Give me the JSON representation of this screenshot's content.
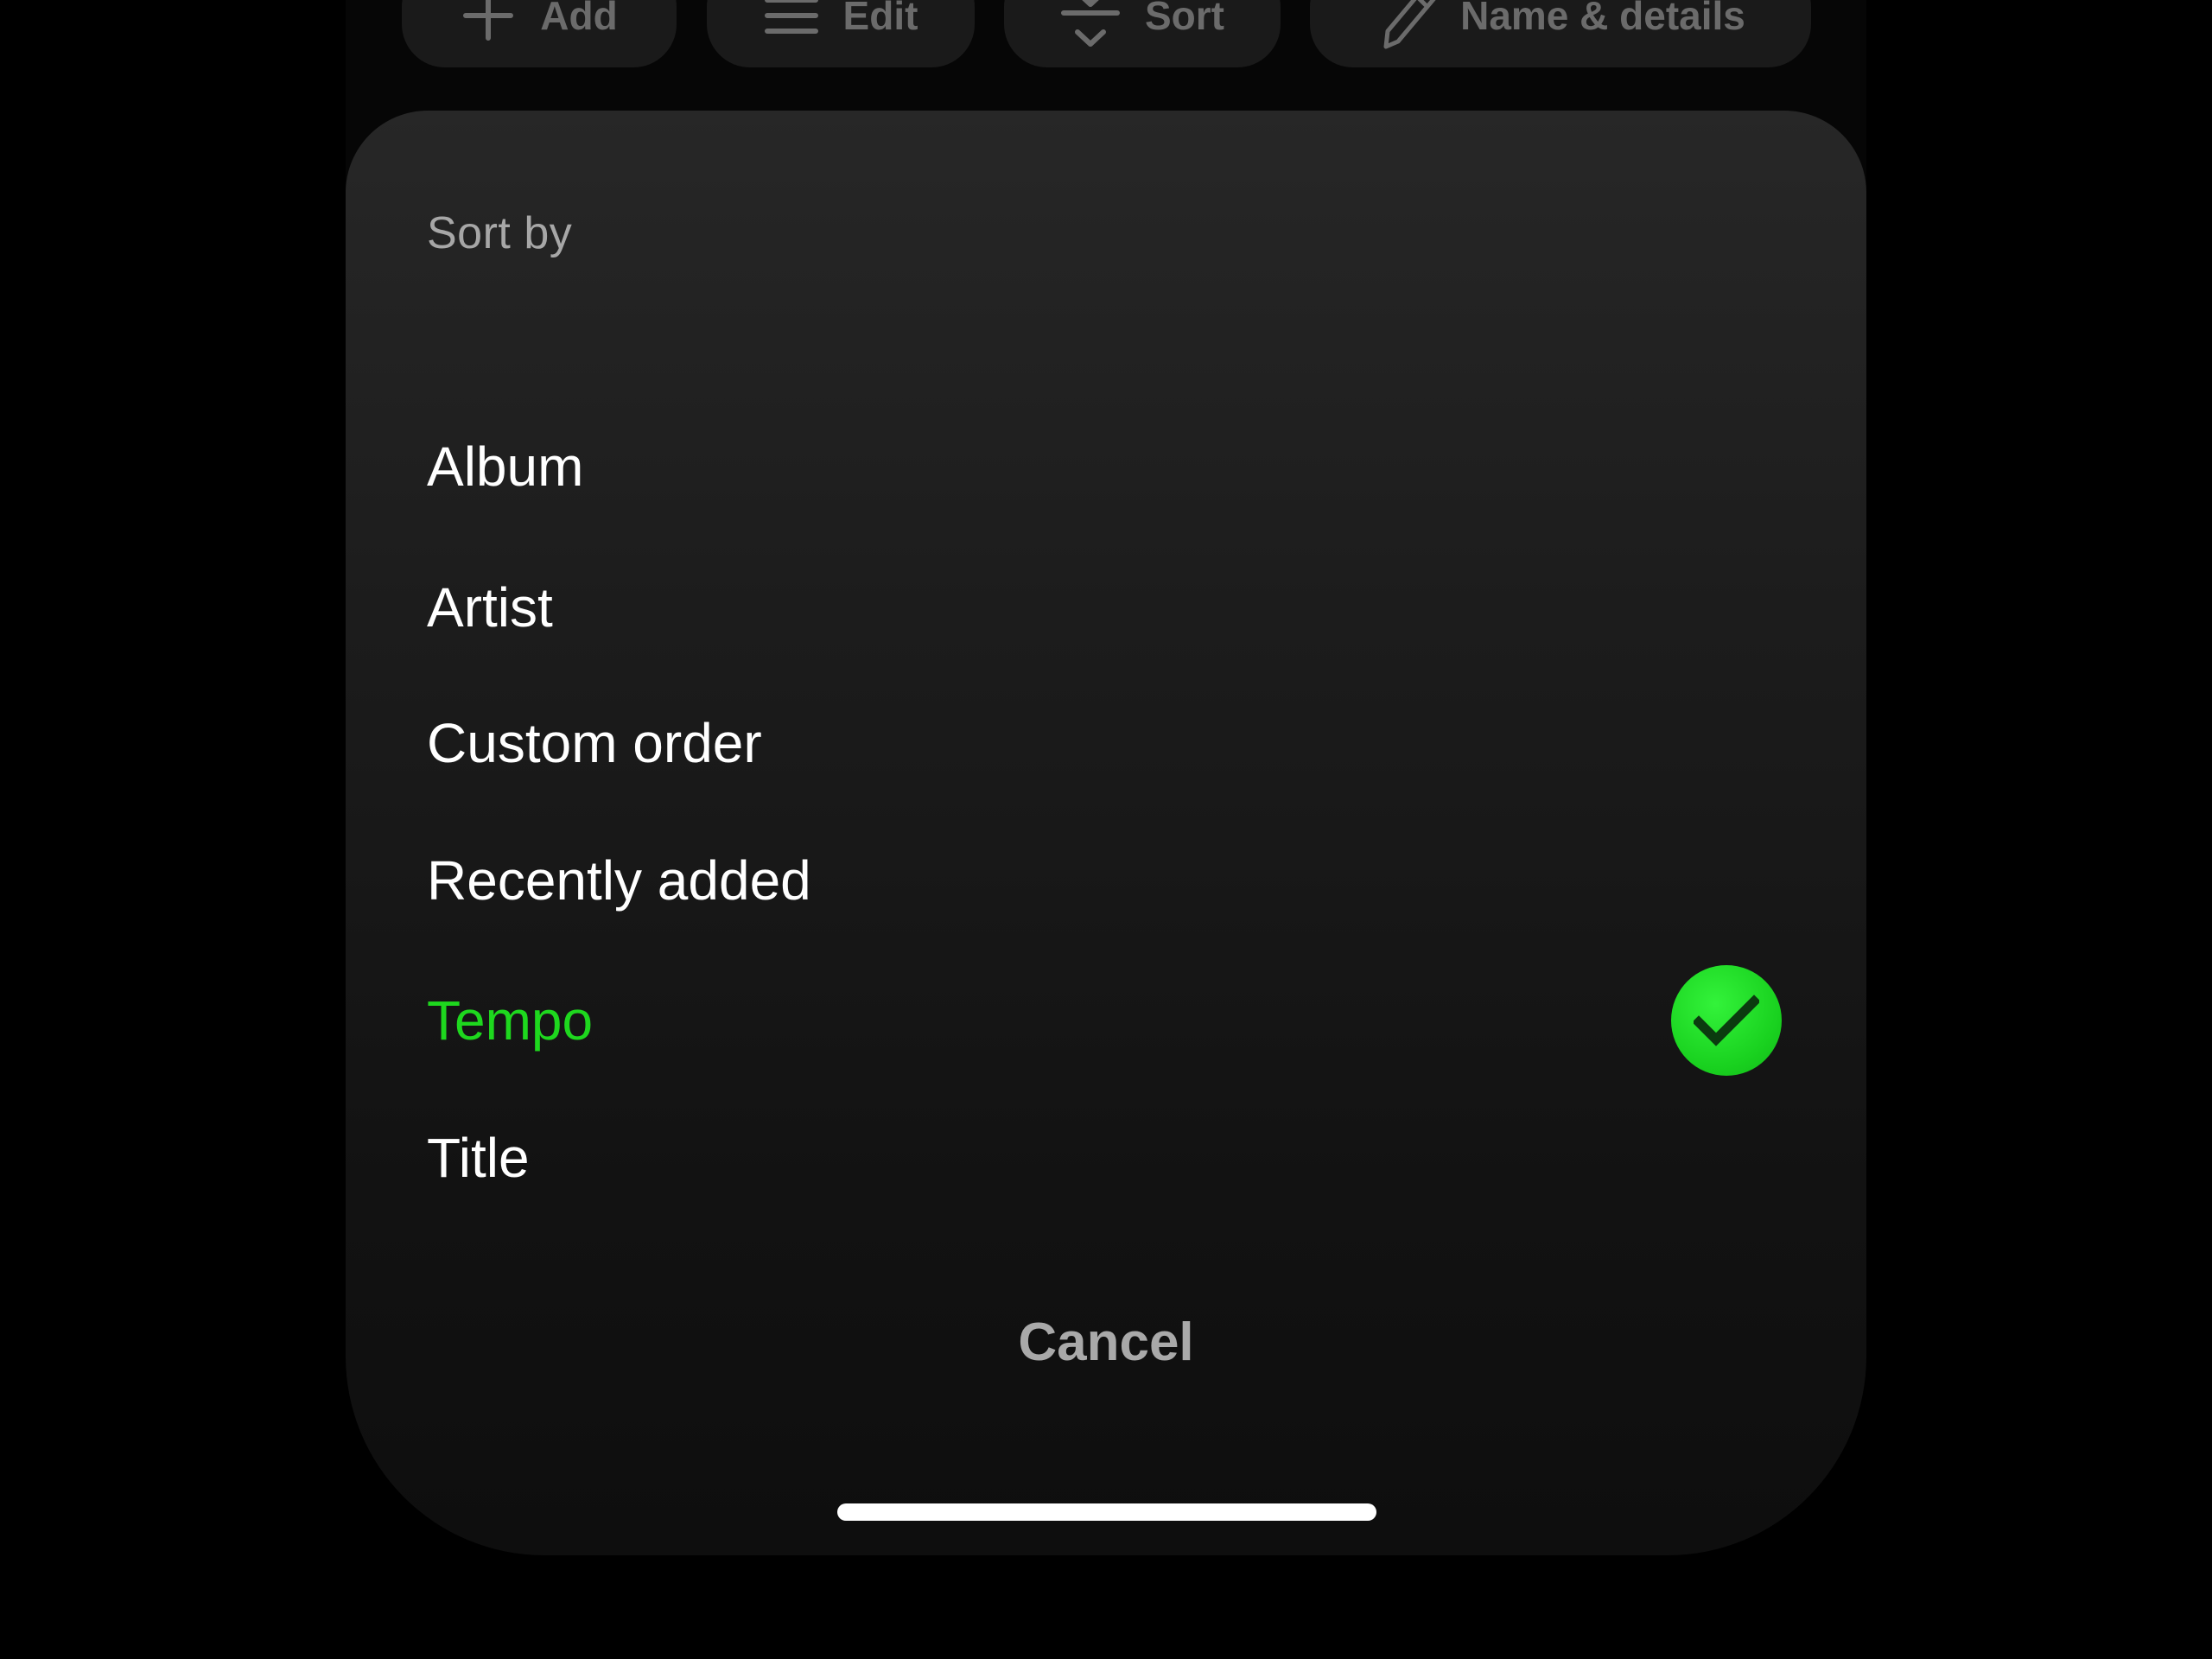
{
  "toolbar": {
    "add_label": "Add",
    "edit_label": "Edit",
    "sort_label": "Sort",
    "name_details_label": "Name & details"
  },
  "sheet": {
    "title": "Sort by",
    "options": [
      {
        "label": "Album",
        "selected": false
      },
      {
        "label": "Artist",
        "selected": false
      },
      {
        "label": "Custom order",
        "selected": false
      },
      {
        "label": "Recently added",
        "selected": false
      },
      {
        "label": "Tempo",
        "selected": true
      },
      {
        "label": "Title",
        "selected": false
      }
    ],
    "cancel_label": "Cancel"
  },
  "colors": {
    "accent": "#1ED81E",
    "text_primary": "#FFFFFF",
    "text_secondary": "#A7A7A7",
    "background": "#000000"
  },
  "icons": {
    "add": "plus-icon",
    "edit": "menu-lines-icon",
    "sort": "sort-arrow-icon",
    "name_details": "pencil-icon",
    "selected": "check-circle-icon"
  }
}
